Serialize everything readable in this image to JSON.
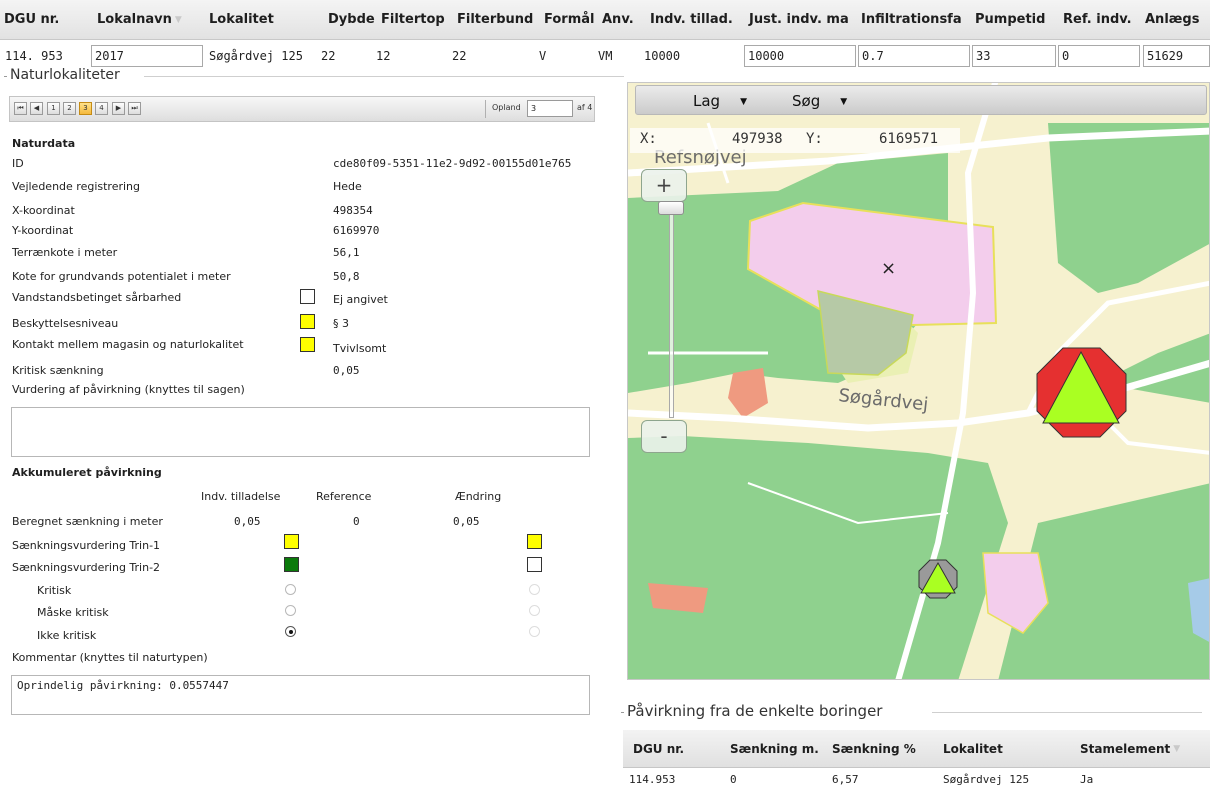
{
  "top_grid": {
    "headers": [
      "DGU nr.",
      "Lokalnavn",
      "Lokalitet",
      "Dybde",
      "Filtertop",
      "Filterbund",
      "Formål",
      "Anv.",
      "Indv. tillad.",
      "Just. indv. ma",
      "Infiltrationsfa",
      "Pumpetid",
      "Ref. indv.",
      "Anlægs"
    ],
    "row": [
      "114. 953",
      "2017",
      "Søgårdvej 125",
      "22",
      "12",
      "22",
      "V",
      "VM",
      "10000",
      "10000",
      "0.7",
      "33",
      "0",
      "51629"
    ]
  },
  "naturlokaliteter": {
    "legend": "Naturlokaliteter",
    "pager": {
      "pages": [
        "1",
        "2",
        "3",
        "4"
      ],
      "current_page": "3",
      "opland_label": "Opland",
      "opland_value": "3",
      "of_label": "af 4"
    },
    "naturdata": {
      "heading": "Naturdata",
      "rows": [
        {
          "label": "ID",
          "value": "cde80f09-5351-11e2-9d92-00155d01e765"
        },
        {
          "label": "Vejledende registrering",
          "value": "Hede"
        },
        {
          "label": "X-koordinat",
          "value": "498354"
        },
        {
          "label": "Y-koordinat",
          "value": "6169970"
        },
        {
          "label": "Terrænkote i meter",
          "value": "56,1"
        },
        {
          "label": "Kote for grundvands potentialet i meter",
          "value": "50,8"
        },
        {
          "label": "Vandstandsbetinget sårbarhed",
          "value": "Ej angivet",
          "color": "#ffffff"
        },
        {
          "label": "Beskyttelsesniveau",
          "value": "§ 3",
          "color": "#ffff00"
        },
        {
          "label": "Kontakt mellem magasin og naturlokalitet",
          "value": "Tvivlsomt",
          "color": "#ffff00"
        },
        {
          "label": "Kritisk sænkning",
          "value": "0,05"
        }
      ],
      "vurdering_label": "Vurdering af påvirkning (knyttes til sagen)",
      "vurdering_value": ""
    },
    "akkumuleret": {
      "heading": "Akkumuleret påvirkning",
      "columns": [
        "Indv. tilladelse",
        "Reference",
        "Ændring"
      ],
      "beregnet_label": "Beregnet sænkning i meter",
      "beregnet_values": [
        "0,05",
        "0",
        "0,05"
      ],
      "trin1_label": "Sænkningsvurdering Trin-1",
      "trin1_colors": [
        "#ffff00",
        "#ffff00"
      ],
      "trin2_label": "Sænkningsvurdering Trin-2",
      "trin2_colors": [
        "#0b7a0b",
        "#ffffff"
      ],
      "options": [
        {
          "label": "Kritisk",
          "left_checked": false
        },
        {
          "label": "Måske kritisk",
          "left_checked": false
        },
        {
          "label": "Ikke kritisk",
          "left_checked": true
        }
      ],
      "kommentar_label": "Kommentar (knyttes til naturtypen)",
      "kommentar_value": "Oprindelig påvirkning: 0.0557447"
    }
  },
  "map": {
    "menu": [
      "Lag",
      "Søg"
    ],
    "x_label": "X:",
    "x_value": "497938",
    "y_label": "Y:",
    "y_value": "6169571",
    "zoom_in": "+",
    "zoom_out": "-",
    "road_labels": [
      "Refsnøjvej",
      "Søgårdvej"
    ],
    "marker_symbol": "×"
  },
  "boringer": {
    "legend": "Påvirkning fra de enkelte boringer",
    "headers": [
      "DGU nr.",
      "Sænkning m.",
      "Sænkning %",
      "Lokalitet",
      "Stamelement"
    ],
    "row": [
      "114.953",
      "0",
      "6,57",
      "Søgårdvej 125",
      "Ja"
    ]
  }
}
